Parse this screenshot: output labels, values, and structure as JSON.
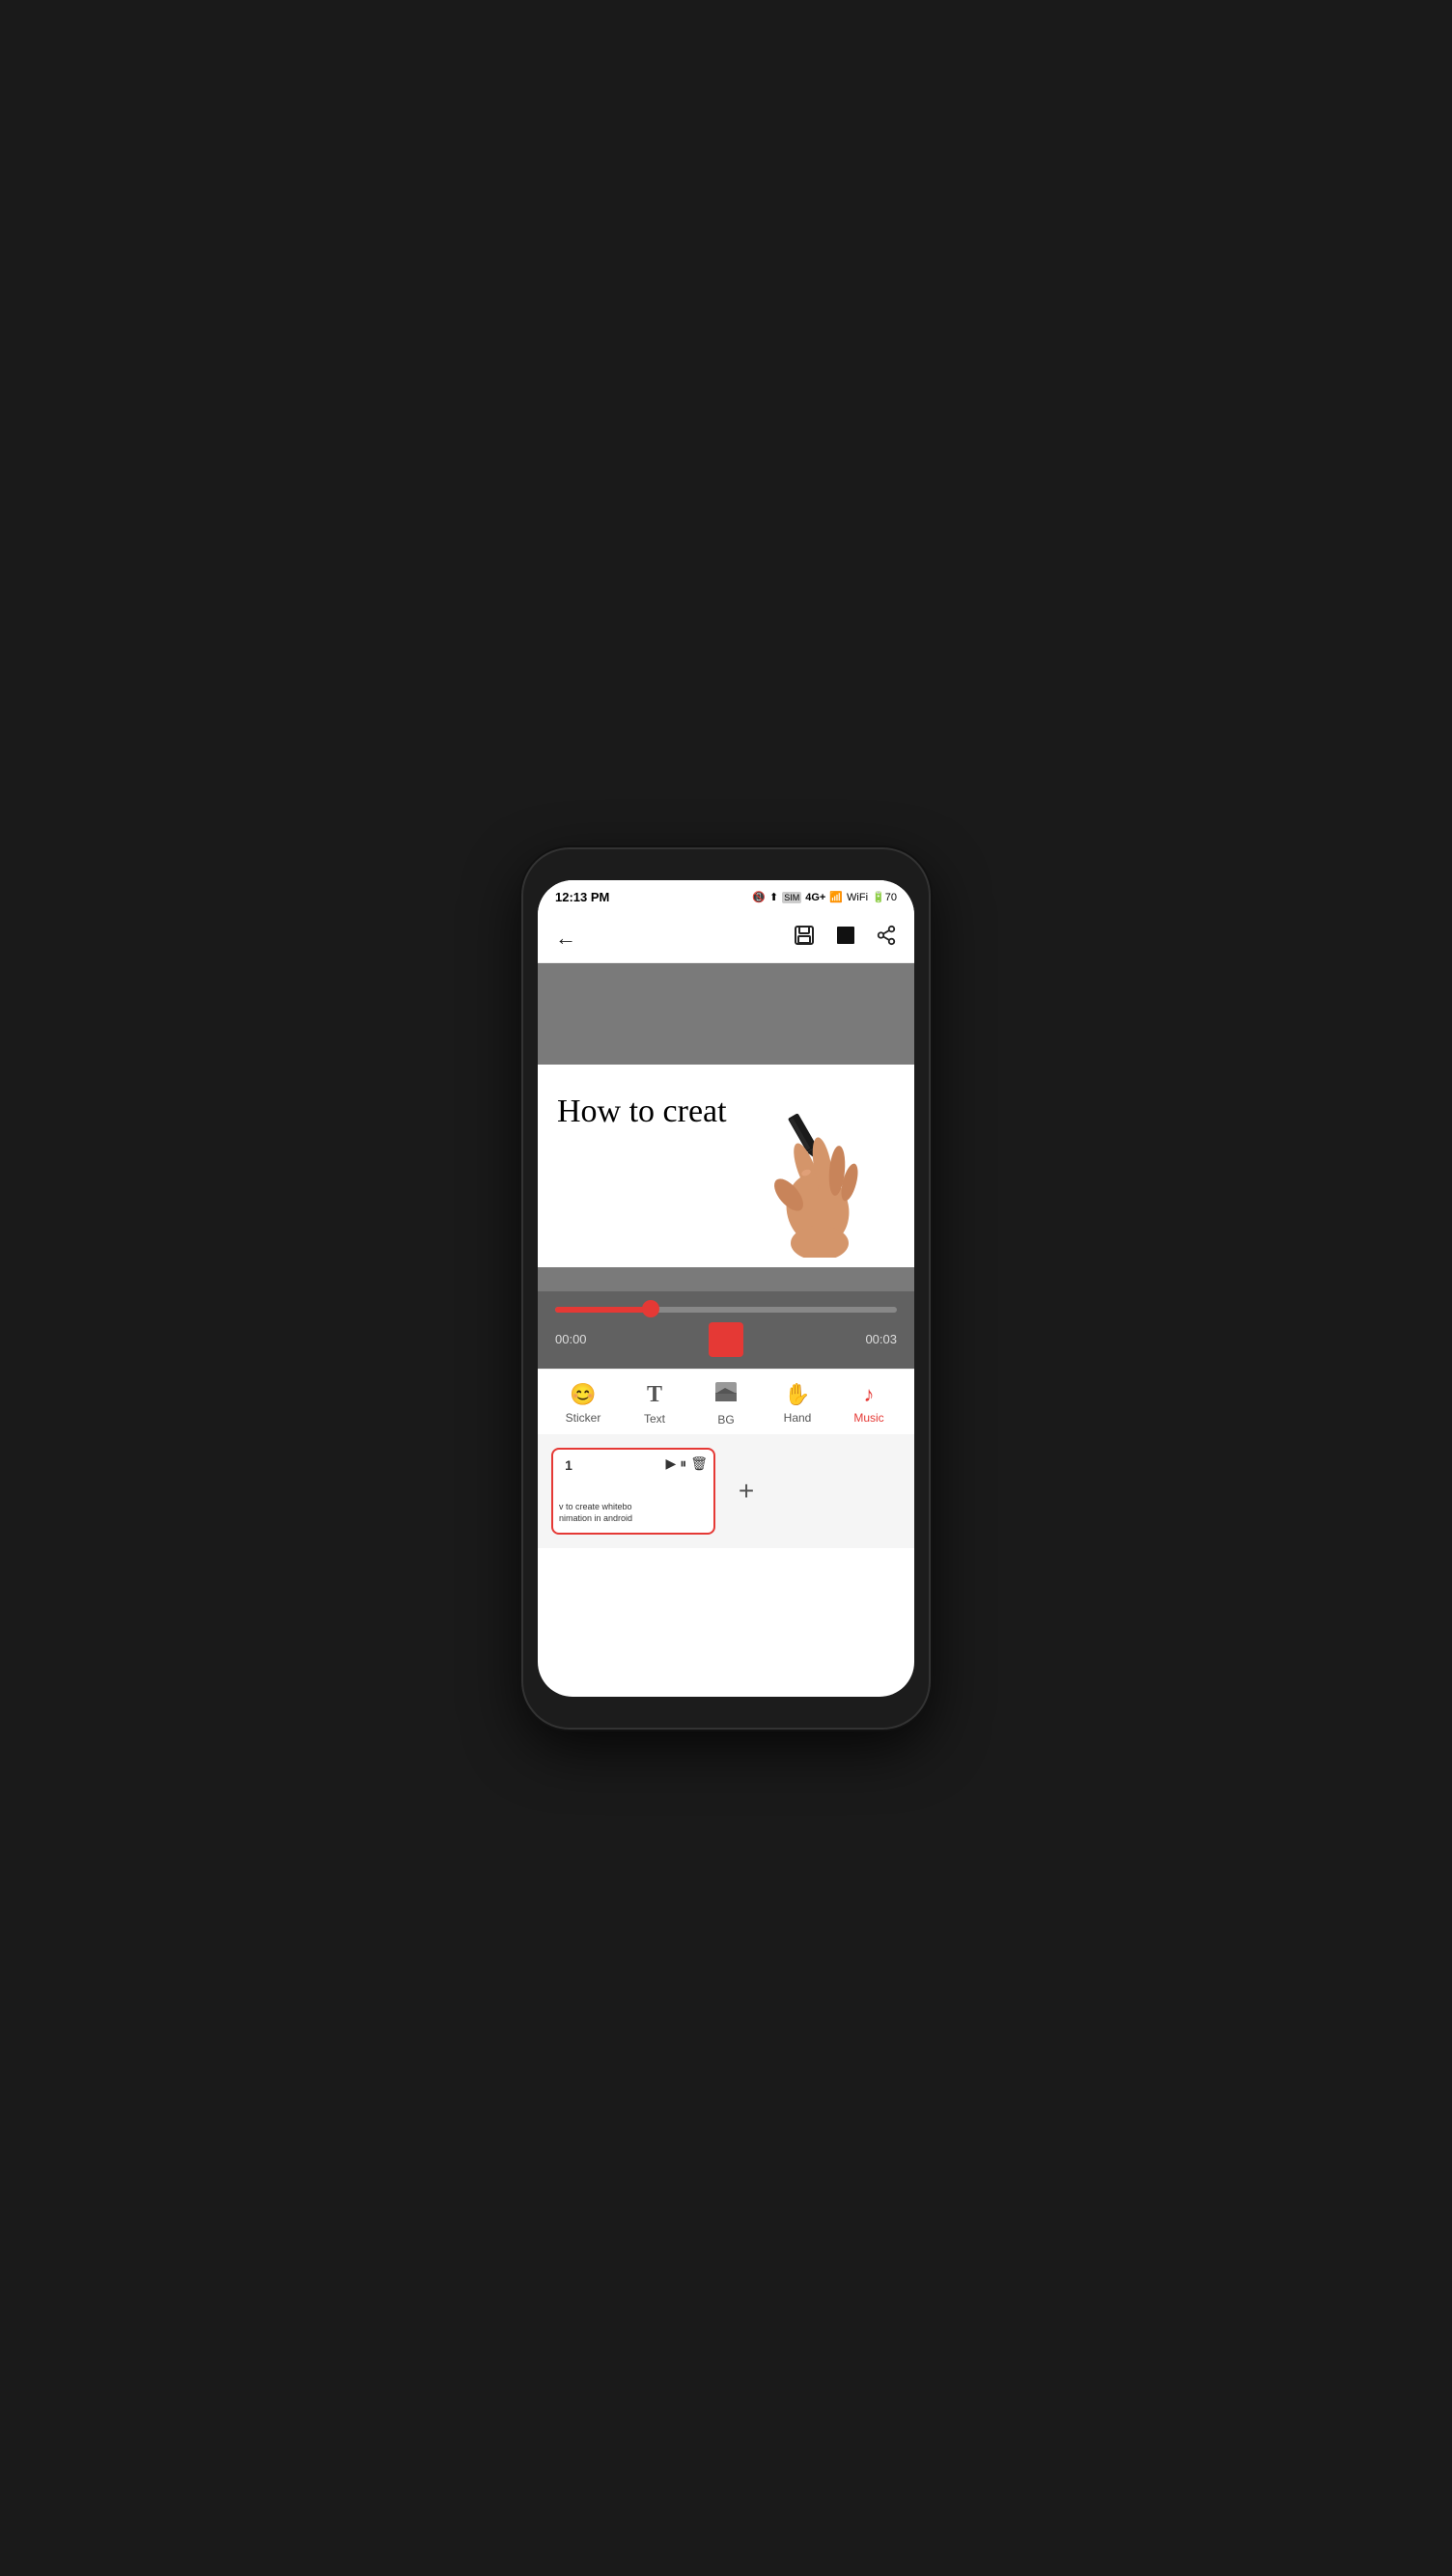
{
  "status_bar": {
    "time": "12:13 PM",
    "network": "4G+",
    "battery": "70"
  },
  "toolbar": {
    "back_label": "←",
    "save_label": "💾",
    "stop_label": "■",
    "share_label": "⎋"
  },
  "video": {
    "writing_text": "How to creat",
    "time_current": "00:00",
    "time_total": "00:03"
  },
  "bottom_tools": [
    {
      "id": "sticker",
      "icon": "😊",
      "label": "Sticker",
      "active": false
    },
    {
      "id": "text",
      "icon": "T",
      "label": "Text",
      "active": false
    },
    {
      "id": "bg",
      "icon": "🖼",
      "label": "BG",
      "active": false
    },
    {
      "id": "hand",
      "icon": "✋",
      "label": "Hand",
      "active": false
    },
    {
      "id": "music",
      "icon": "♪",
      "label": "Music",
      "active": true
    }
  ],
  "clip": {
    "number": "1",
    "preview_line1": "v to create whitebo",
    "preview_line2": "nimation in android",
    "add_button_label": "+"
  }
}
